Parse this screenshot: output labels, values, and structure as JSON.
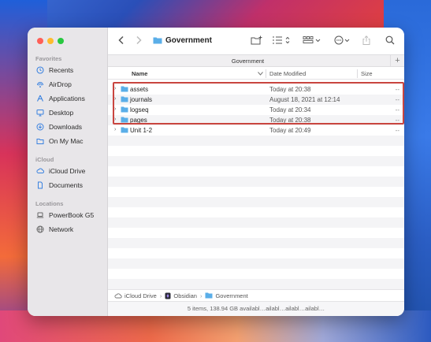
{
  "window": {
    "title": "Government"
  },
  "sidebar": {
    "favorites_header": "Favorites",
    "favorites": [
      {
        "label": "Recents",
        "icon": "clock-icon"
      },
      {
        "label": "AirDrop",
        "icon": "airdrop-icon"
      },
      {
        "label": "Applications",
        "icon": "applications-icon"
      },
      {
        "label": "Desktop",
        "icon": "desktop-icon"
      },
      {
        "label": "Downloads",
        "icon": "downloads-icon"
      },
      {
        "label": "On My Mac",
        "icon": "folder-icon"
      }
    ],
    "icloud_header": "iCloud",
    "icloud": [
      {
        "label": "iCloud Drive",
        "icon": "cloud-icon"
      },
      {
        "label": "Documents",
        "icon": "document-icon"
      }
    ],
    "locations_header": "Locations",
    "locations": [
      {
        "label": "PowerBook G5",
        "icon": "laptop-icon"
      },
      {
        "label": "Network",
        "icon": "globe-icon"
      }
    ]
  },
  "tabbar": {
    "title": "Government",
    "add_label": "+"
  },
  "columns": {
    "name": "Name",
    "date": "Date Modified",
    "size": "Size"
  },
  "rows": [
    {
      "name": "assets",
      "date": "Today at 20:38",
      "size": "--"
    },
    {
      "name": "journals",
      "date": "August 18, 2021 at 12:14",
      "size": "--"
    },
    {
      "name": "logseq",
      "date": "Today at 20:34",
      "size": "--"
    },
    {
      "name": "pages",
      "date": "Today at 20:38",
      "size": "--"
    },
    {
      "name": "Unit 1-2",
      "date": "Today at 20:49",
      "size": "--"
    }
  ],
  "pathbar": {
    "items": [
      "iCloud Drive",
      "Obsidian",
      "Government"
    ]
  },
  "statusbar": {
    "text": "5 items, 138.94 GB availabl…ailabl…ailabl…ailabl…"
  },
  "colors": {
    "folder": "#5aaee8",
    "highlight": "#c9453f",
    "close": "#ff5f57",
    "minimize": "#febc2e",
    "zoom": "#28c840"
  }
}
